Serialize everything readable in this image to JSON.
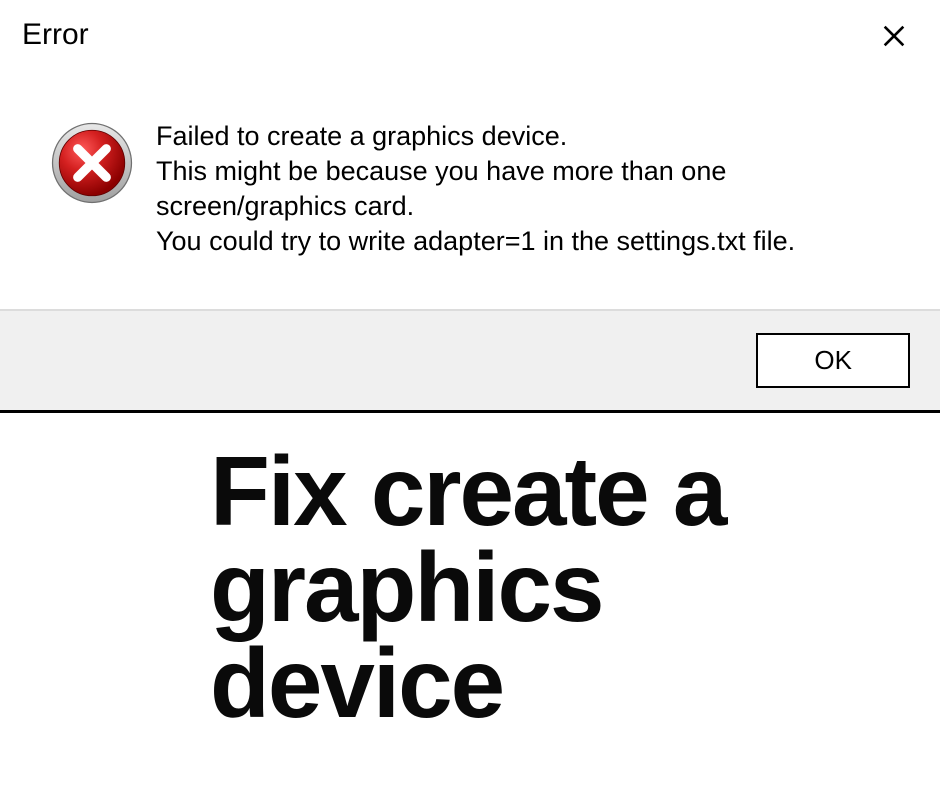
{
  "dialog": {
    "title": "Error",
    "message_line1": "Failed to create a graphics device.",
    "message_line2": "This might be because you have more than one screen/graphics card.",
    "message_line3": "You could try to write adapter=1 in the settings.txt file.",
    "ok_label": "OK"
  },
  "headline": {
    "text": "Fix create a graphics device"
  },
  "colors": {
    "error_red": "#c41e1e",
    "error_red_dark": "#8b0000"
  }
}
